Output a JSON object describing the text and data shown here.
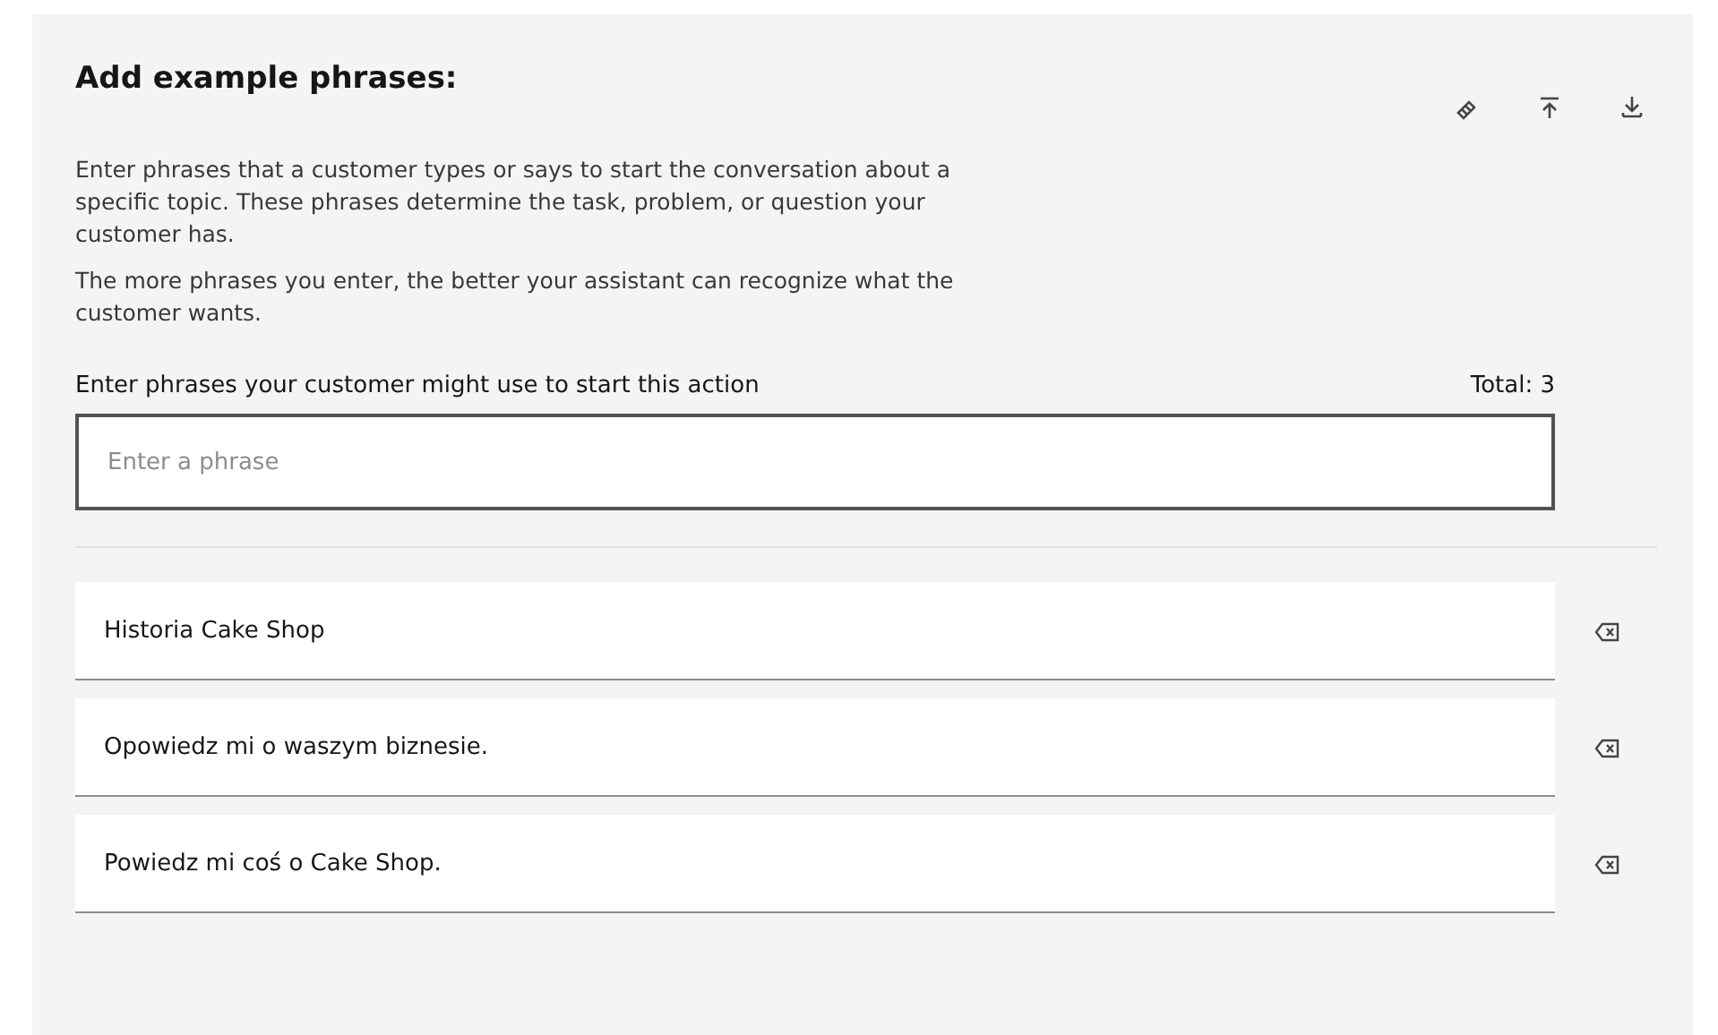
{
  "title": "Add example phrases:",
  "toolbar": [
    {
      "kind": "edit"
    },
    {
      "kind": "upload"
    },
    {
      "kind": "download"
    }
  ],
  "paragraphs": [
    "Enter phrases that a customer types or says to start the conversation about a specific topic. These phrases determine the task, problem, or question your customer has.",
    "The more phrases you enter, the better your assistant can recognize what the customer wants."
  ],
  "input": {
    "label": "Enter phrases your customer might use to start this action",
    "total": "Total: 3",
    "placeholder": "Enter a phrase"
  },
  "phrases": [
    "Historia Cake Shop",
    "Opowiedz mi o waszym biznesie.",
    "Powiedz mi coś o Cake Shop."
  ]
}
